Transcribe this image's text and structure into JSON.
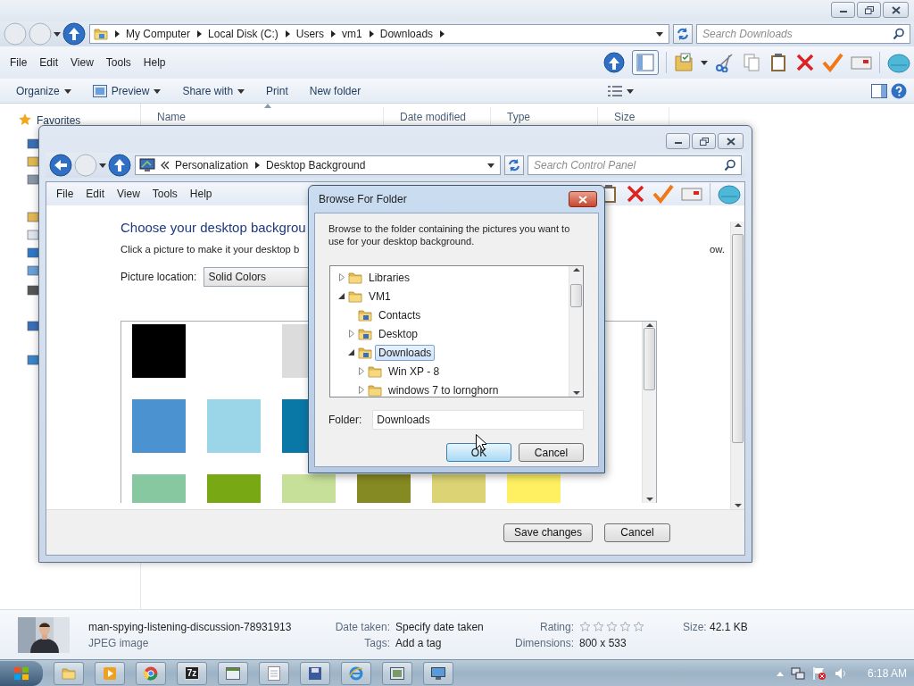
{
  "explorer": {
    "address": [
      "My Computer",
      "Local Disk (C:)",
      "Users",
      "vm1",
      "Downloads"
    ],
    "search_placeholder": "Search Downloads",
    "menu": [
      "File",
      "Edit",
      "View",
      "Tools",
      "Help"
    ],
    "commands": [
      {
        "label": "Organize",
        "dropdown": true
      },
      {
        "label": "Preview",
        "dropdown": true
      },
      {
        "label": "Share with",
        "dropdown": true
      },
      {
        "label": "Print",
        "dropdown": false
      },
      {
        "label": "New folder",
        "dropdown": false
      }
    ],
    "nav": {
      "favorites": "Favorites"
    },
    "columns": [
      "Name",
      "Date modified",
      "Type",
      "Size"
    ],
    "details": {
      "filename": "man-spying-listening-discussion-78931913",
      "filetype": "JPEG image",
      "date_label": "Date taken:",
      "date_value": "Specify date taken",
      "tags_label": "Tags:",
      "tags_value": "Add a tag",
      "rating_label": "Rating:",
      "stars": 0,
      "dimensions_label": "Dimensions:",
      "dimensions_value": "800 x 533",
      "size_label": "Size:",
      "size_value": "42.1 KB"
    }
  },
  "control_panel": {
    "address": [
      "Personalization",
      "Desktop Background"
    ],
    "search_placeholder": "Search Control Panel",
    "menu": [
      "File",
      "Edit",
      "View",
      "Tools",
      "Help"
    ],
    "heading": "Choose your desktop backgrou",
    "instruction": "Click a picture to make it your desktop b",
    "instruction_tail": "ow.",
    "location_label": "Picture location:",
    "location_value": "Solid Colors",
    "swatches": [
      [
        {
          "color": "#000000"
        },
        {
          "kind": "blank"
        },
        {
          "color": "#dcdcdc"
        }
      ],
      [
        {
          "color": "#4a92d0"
        },
        {
          "color": "#9ad6e8"
        },
        {
          "color": "#0a78a6"
        }
      ],
      [
        {
          "color": "#88c8a0"
        },
        {
          "color": "#78a814"
        },
        {
          "color": "#c6e09a"
        },
        {
          "color": "#868a22"
        },
        {
          "color": "#dcd474"
        },
        {
          "color": "#fff062"
        }
      ]
    ],
    "buttons": [
      "Save changes",
      "Cancel"
    ]
  },
  "dialog": {
    "title": "Browse For Folder",
    "description": "Browse to the folder containing the pictures you want to use for your desktop background.",
    "tree": [
      {
        "label": "Libraries",
        "expanded": false,
        "selected": false
      },
      {
        "label": "VM1",
        "expanded": true,
        "selected": false,
        "children": [
          {
            "label": "Contacts",
            "selected": false
          },
          {
            "label": "Desktop",
            "expanded": false,
            "selected": false
          },
          {
            "label": "Downloads",
            "expanded": true,
            "selected": true,
            "children": [
              {
                "label": "Win XP - 8",
                "expanded": false,
                "selected": false
              },
              {
                "label": "windows 7 to lornghorn",
                "expanded": false,
                "selected": false
              }
            ]
          }
        ]
      }
    ],
    "folder_label": "Folder:",
    "folder_value": "Downloads",
    "buttons": [
      {
        "label": "OK",
        "highlighted": true
      },
      {
        "label": "Cancel",
        "highlighted": false
      }
    ]
  },
  "taskbar": {
    "label_7z": "7z",
    "clock": "6:18 AM"
  }
}
